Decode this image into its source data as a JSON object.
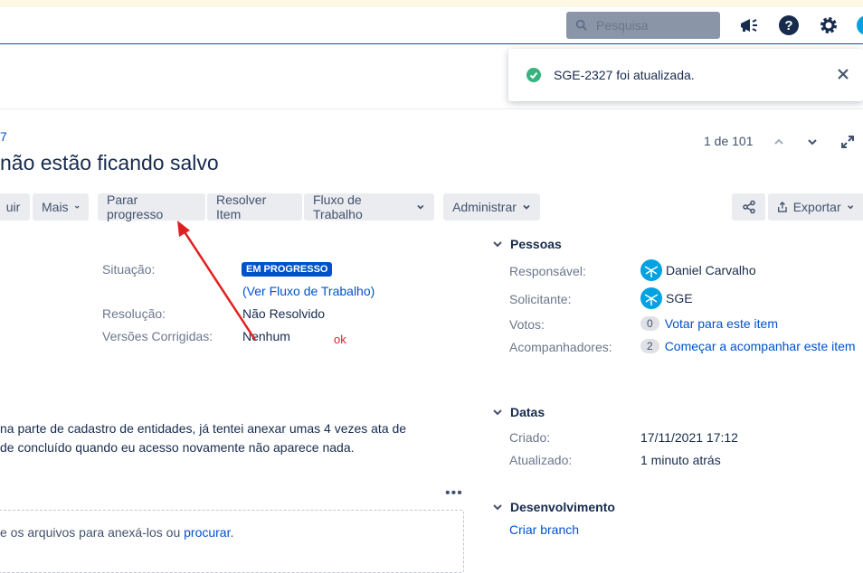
{
  "topbar": {
    "search_placeholder": "Pesquisa",
    "icons": [
      "search-icon",
      "megaphone-icon",
      "help-icon",
      "gear-icon",
      "avatar-icon"
    ]
  },
  "toast": {
    "message": "SGE-2327 foi atualizada.",
    "status_color": "#36b37e"
  },
  "issue": {
    "key_fragment": "7",
    "title_fragment": "não estão ficando salvo"
  },
  "pager": {
    "text": "1 de 101"
  },
  "actions": {
    "atribuir_fragment": "uir",
    "mais": "Mais",
    "parar_progresso": "Parar progresso",
    "resolver_item": "Resolver Item",
    "fluxo_trabalho": "Fluxo de Trabalho",
    "administrar": "Administrar",
    "exportar": "Exportar"
  },
  "details": {
    "situacao_label": "Situação:",
    "situacao_value": "EM PROGRESSO",
    "ver_fluxo": "(Ver Fluxo de Trabalho)",
    "resolucao_label": "Resolução:",
    "resolucao_value": "Não Resolvido",
    "versoes_label": "Versões Corrigidas:",
    "versoes_value": "Nenhum",
    "status_color": "#0052cc"
  },
  "annotation": {
    "ok_text": "ok",
    "arrow_color": "#e02020"
  },
  "description": {
    "line1": "na parte de cadastro de entidades, já tentei anexar umas 4 vezes ata de",
    "line2": "de concluído quando eu acesso novamente não aparece nada."
  },
  "attachments": {
    "drop_text": "e os arquivos para anexá-los ou ",
    "drop_link": "procurar."
  },
  "pessoas": {
    "title": "Pessoas",
    "responsavel_label": "Responsável:",
    "responsavel_value": "Daniel Carvalho",
    "solicitante_label": "Solicitante:",
    "solicitante_value": "SGE",
    "votos_label": "Votos:",
    "votos_count": "0",
    "votos_link": "Votar para este item",
    "acomp_label": "Acompanhadores:",
    "acomp_count": "2",
    "acomp_link": "Começar a acompanhar este item"
  },
  "datas": {
    "title": "Datas",
    "criado_label": "Criado:",
    "criado_value": "17/11/2021 17:12",
    "atualizado_label": "Atualizado:",
    "atualizado_value": "1 minuto atrás"
  },
  "desenvolvimento": {
    "title": "Desenvolvimento",
    "criar_branch": "Criar branch"
  }
}
